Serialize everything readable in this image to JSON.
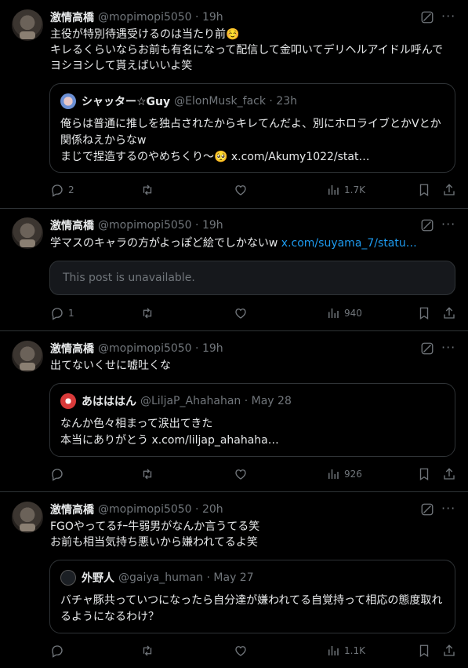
{
  "icons": {
    "grok": "grok-icon",
    "more": "more-icon",
    "reply": "reply-icon",
    "retweet": "retweet-icon",
    "like": "like-icon",
    "views": "views-icon",
    "bookmark": "bookmark-icon",
    "share": "share-icon"
  },
  "colors": {
    "background": "#000000",
    "text": "#e7e9ea",
    "muted": "#71767b",
    "link": "#1d9bf0",
    "border": "#2f3336"
  },
  "more_label": "···",
  "tweets": [
    {
      "name": "激情高橋",
      "meta": "@mopimopi5050 · 19h",
      "text": "主役が特別待遇受けるのは当たり前☺️\nキレるくらいならお前も有名になって配信して金叩いてデリヘルアイドル呼んでヨシヨシして貰えばいいよ笑",
      "quote": {
        "name": "シャッター☆Guy",
        "meta": "@ElonMusk_fack · 23h",
        "text": "俺らは普通に推しを独占されたからキレてんだよ、別にホロライブとかVとか関係ねえからなw\nまじで捏造するのやめちくり〜🥺 x.com/Akumy1022/stat…"
      },
      "stats": {
        "replies": "2",
        "views": "1.7K"
      }
    },
    {
      "name": "激情高橋",
      "meta": "@mopimopi5050 · 19h",
      "text": "学マスのキャラの方がよっぽど絵でしかないw",
      "link": "x.com/suyama_7/statu…",
      "unavailable": "This post is unavailable.",
      "stats": {
        "replies": "1",
        "views": "940"
      }
    },
    {
      "name": "激情高橋",
      "meta": "@mopimopi5050 · 19h",
      "text": "出てないくせに嘘吐くな",
      "quote": {
        "name": "あはははん",
        "meta": "@LiljaP_Ahahahan · May 28",
        "text": "なんか色々相まって涙出てきた\n本当にありがとう x.com/liljap_ahahaha…"
      },
      "stats": {
        "replies": "",
        "views": "926"
      }
    },
    {
      "name": "激情高橋",
      "meta": "@mopimopi5050 · 20h",
      "text": "FGOやってるﾁｰ牛弱男がなんか言うてる笑\nお前も相当気持ち悪いから嫌われてるよ笑",
      "quote": {
        "name": "外野人",
        "meta": "@gaiya_human · May 27",
        "text": "バチャ豚共っていつになったら自分達が嫌われてる自覚持って相応の態度取れるようになるわけ？"
      },
      "stats": {
        "replies": "",
        "views": "1.1K"
      }
    }
  ]
}
